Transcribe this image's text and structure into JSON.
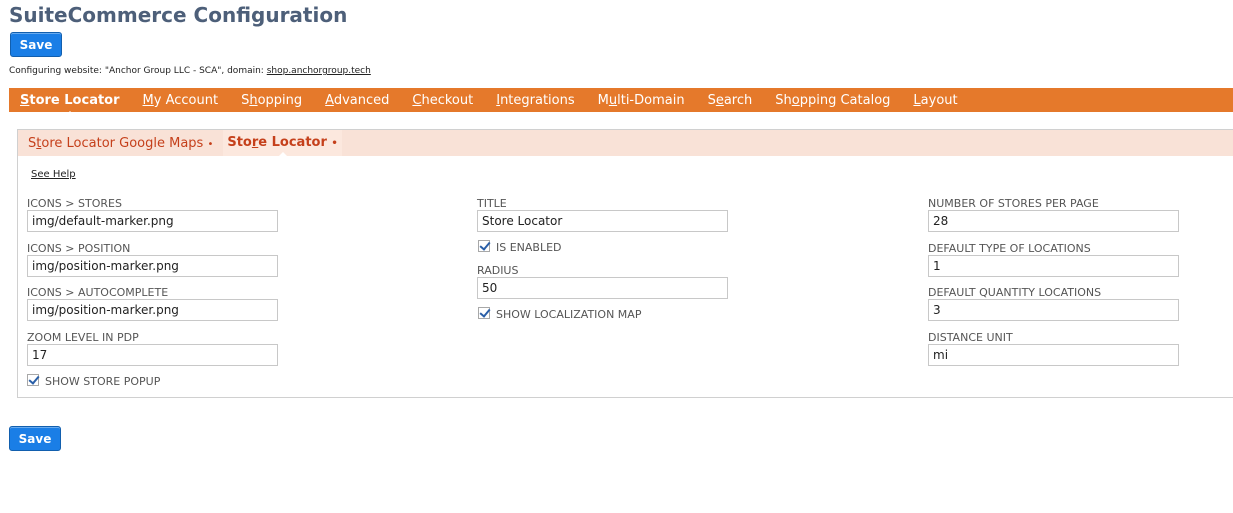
{
  "page": {
    "title": "SuiteCommerce Configuration"
  },
  "actions": {
    "save_label": "Save"
  },
  "config_info": {
    "prefix": "Configuring website: \"Anchor Group LLC - SCA\", domain: ",
    "domain": "shop.anchorgroup.tech"
  },
  "colors": {
    "nav_bg": "#e5792b",
    "subtab_bg": "#f9e2d7",
    "subtab_text": "#c5401b",
    "button_bg": "#1a7ee6",
    "title": "#4d5f79"
  },
  "nav": {
    "tabs": [
      {
        "pre": "",
        "key": "S",
        "post": "tore Locator",
        "active": true
      },
      {
        "pre": "",
        "key": "M",
        "post": "y Account",
        "active": false
      },
      {
        "pre": "S",
        "key": "h",
        "post": "opping",
        "active": false
      },
      {
        "pre": "",
        "key": "A",
        "post": "dvanced",
        "active": false
      },
      {
        "pre": "",
        "key": "C",
        "post": "heckout",
        "active": false
      },
      {
        "pre": "",
        "key": "I",
        "post": "ntegrations",
        "active": false
      },
      {
        "pre": "M",
        "key": "u",
        "post": "lti-Domain",
        "active": false
      },
      {
        "pre": "S",
        "key": "e",
        "post": "arch",
        "active": false
      },
      {
        "pre": "Sh",
        "key": "o",
        "post": "pping Catalog",
        "active": false
      },
      {
        "pre": "",
        "key": "L",
        "post": "ayout",
        "active": false
      }
    ]
  },
  "subtabs": [
    {
      "pre": "S",
      "key": "t",
      "post": "ore Locator Google Maps",
      "dot": "•",
      "active": false
    },
    {
      "pre": "Sto",
      "key": "r",
      "post": "e Locator",
      "dot": "•",
      "active": true
    }
  ],
  "help": {
    "label": "See Help"
  },
  "form": {
    "icons_stores": {
      "label": "ICONS > STORES",
      "value": "img/default-marker.png"
    },
    "icons_position": {
      "label": "ICONS > POSITION",
      "value": "img/position-marker.png"
    },
    "icons_autocomplete": {
      "label": "ICONS > AUTOCOMPLETE",
      "value": "img/position-marker.png"
    },
    "zoom_level": {
      "label": "ZOOM LEVEL IN PDP",
      "value": "17"
    },
    "show_store_popup": {
      "label": "SHOW STORE POPUP",
      "checked": true
    },
    "title": {
      "label": "TITLE",
      "value": "Store Locator"
    },
    "is_enabled": {
      "label": "IS ENABLED",
      "checked": true
    },
    "radius": {
      "label": "RADIUS",
      "value": "50"
    },
    "show_localization_map": {
      "label": "SHOW LOCALIZATION MAP",
      "checked": true
    },
    "stores_per_page": {
      "label": "NUMBER OF STORES PER PAGE",
      "value": "28"
    },
    "default_type_locations": {
      "label": "DEFAULT TYPE OF LOCATIONS",
      "value": "1"
    },
    "default_quantity_locations": {
      "label": "DEFAULT QUANTITY LOCATIONS",
      "value": "3"
    },
    "distance_unit": {
      "label": "DISTANCE UNIT",
      "value": "mi"
    }
  }
}
